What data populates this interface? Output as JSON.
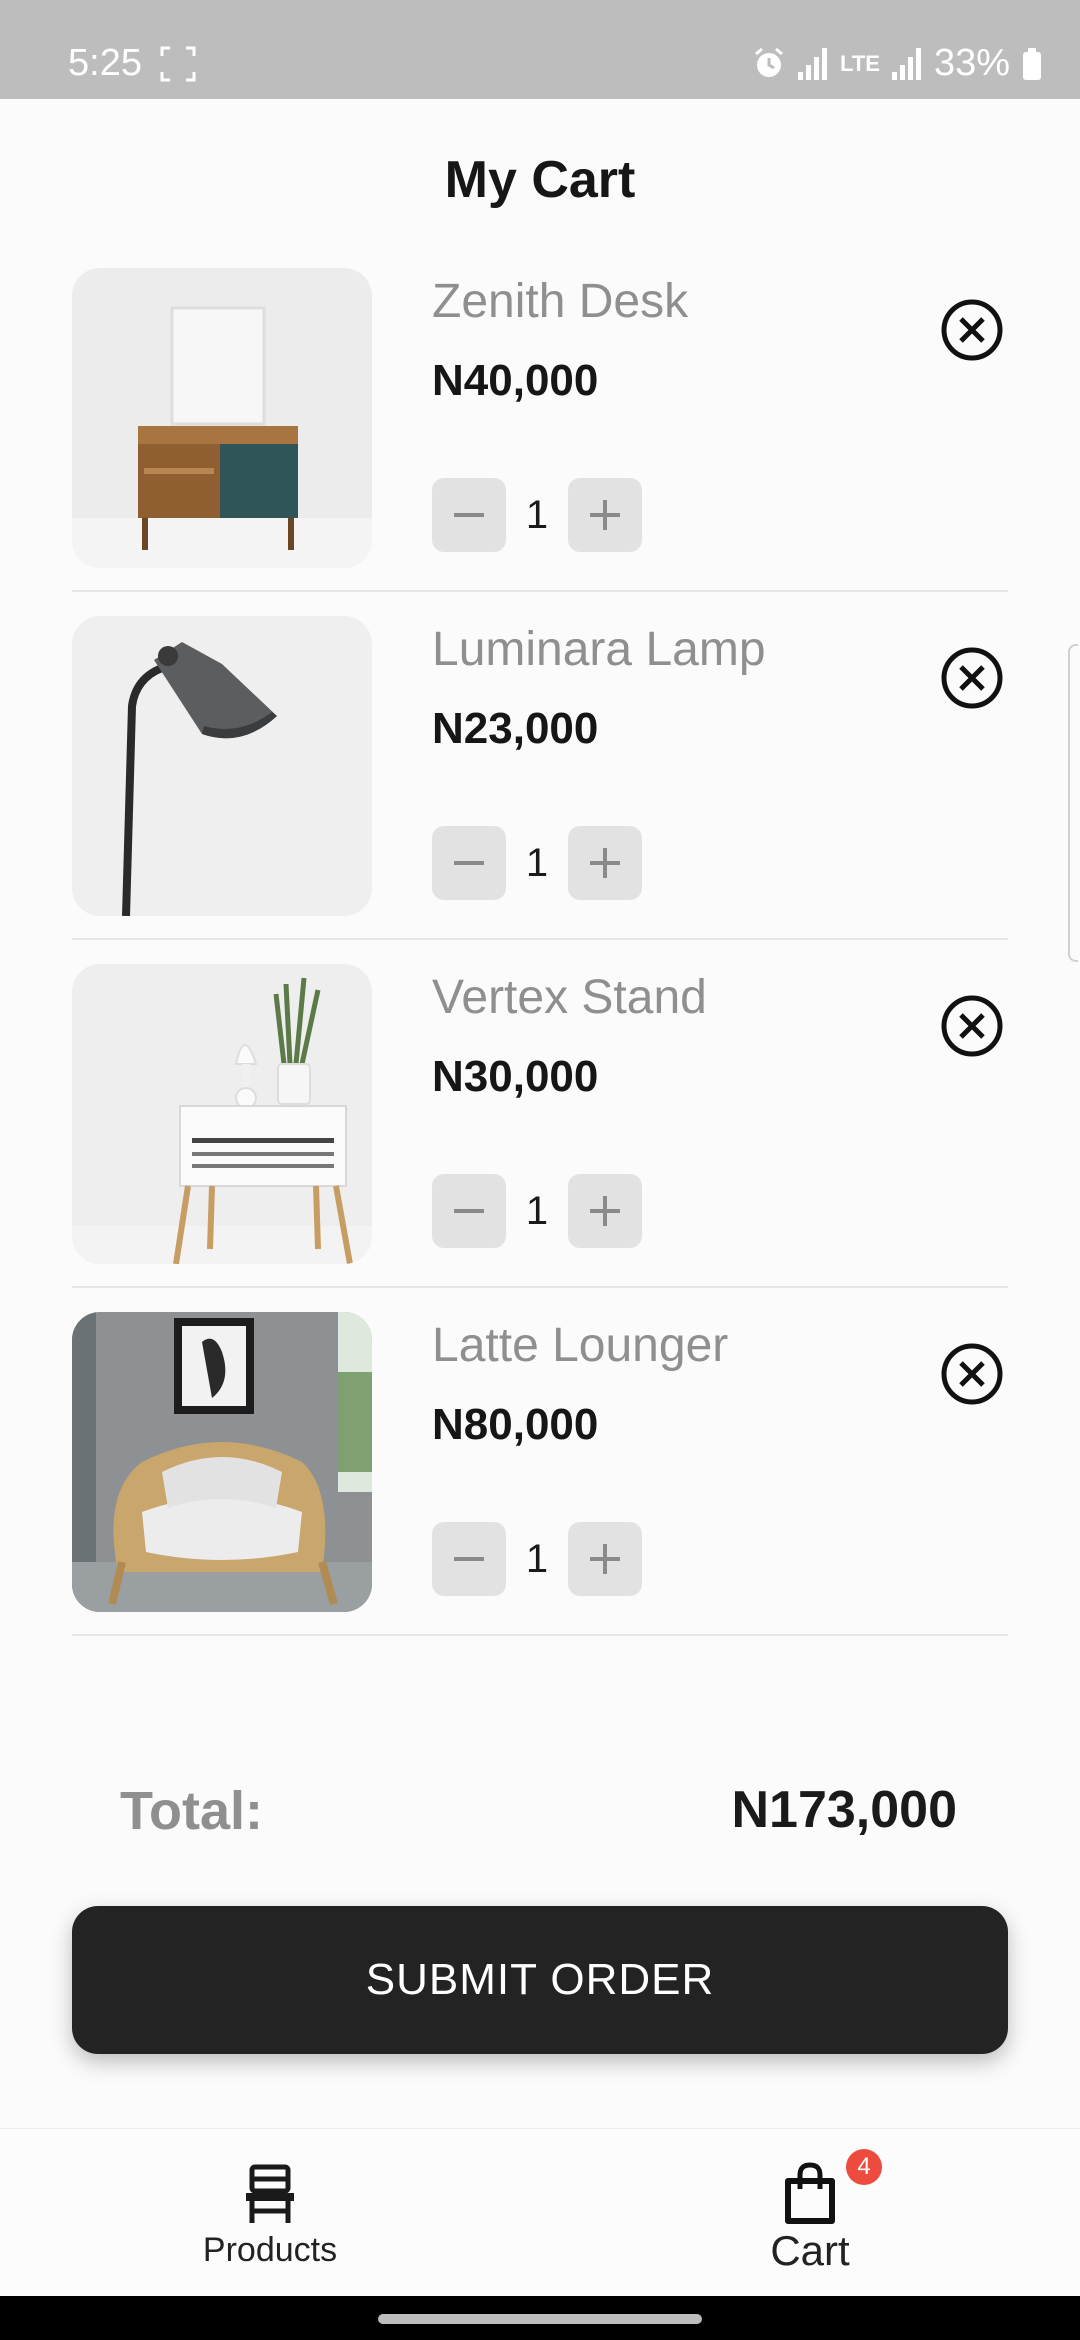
{
  "status_bar": {
    "time": "5:25",
    "network": "LTE",
    "battery": "33%"
  },
  "page": {
    "title": "My Cart"
  },
  "items": [
    {
      "name": "Zenith Desk",
      "price": "N40,000",
      "quantity": "1",
      "thumbnail": "desk-photo"
    },
    {
      "name": "Luminara Lamp",
      "price": "N23,000",
      "quantity": "1",
      "thumbnail": "lamp-photo"
    },
    {
      "name": "Vertex Stand",
      "price": "N30,000",
      "quantity": "1",
      "thumbnail": "stand-photo"
    },
    {
      "name": "Latte Lounger",
      "price": "N80,000",
      "quantity": "1",
      "thumbnail": "chair-photo"
    }
  ],
  "summary": {
    "total_label": "Total:",
    "total_value": "N173,000"
  },
  "actions": {
    "submit_label": "SUBMIT ORDER"
  },
  "nav": {
    "products_label": "Products",
    "cart_label": "Cart",
    "cart_badge": "4"
  },
  "colors": {
    "accent": "#232323",
    "badge": "#ee4b3f",
    "muted_text": "#8f8f8f",
    "status_bar": "#bdbdbd"
  }
}
